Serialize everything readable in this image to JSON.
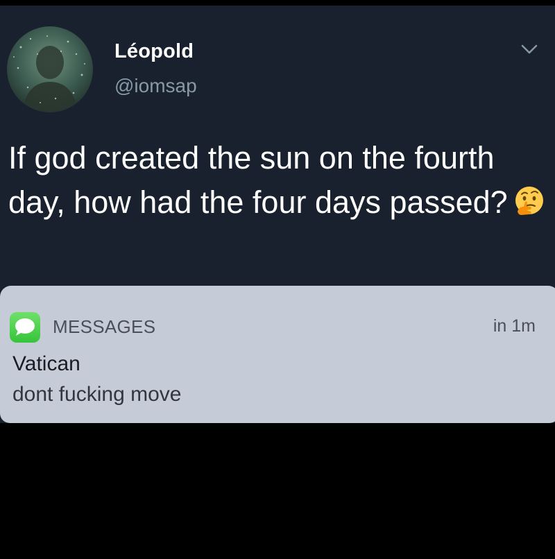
{
  "tweet": {
    "display_name": "Léopold",
    "handle": "@iomsap",
    "text": "If god created the sun on the fourth day, how had the four days passed?",
    "emoji": "thinking-face"
  },
  "notification": {
    "app_name": "MESSAGES",
    "time": "in 1m",
    "sender": "Vatican",
    "message": "dont fucking move"
  },
  "colors": {
    "tweet_background": "#18212d",
    "notification_background": "#c6cbd8",
    "messages_icon": "#3fc83c"
  }
}
